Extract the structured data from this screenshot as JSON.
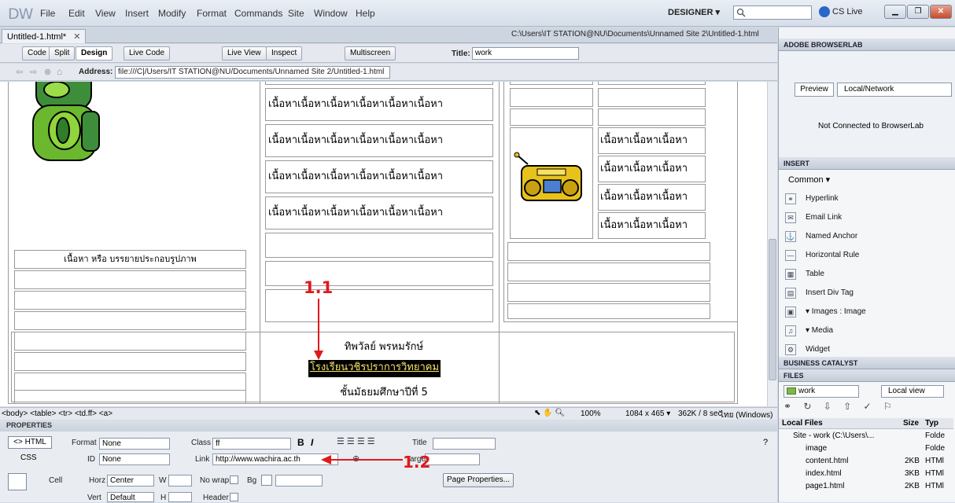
{
  "app": {
    "logo": "DW",
    "workspace": "DESIGNER ▾",
    "cslive": "CS Live"
  },
  "menu": [
    "File",
    "Edit",
    "View",
    "Insert",
    "Modify",
    "Format",
    "Commands",
    "Site",
    "Window",
    "Help"
  ],
  "doc": {
    "tab": "Untitled-1.html*",
    "path": "C:\\Users\\IT STATION@NU\\Documents\\Unnamed Site 2\\Untitled-1.html"
  },
  "toolbar": {
    "code": "Code",
    "split": "Split",
    "design": "Design",
    "live_code": "Live Code",
    "live_view": "Live View",
    "inspect": "Inspect",
    "multiscreen": "Multiscreen",
    "title_label": "Title:",
    "title_value": "work"
  },
  "address": {
    "label": "Address:",
    "value": "file:///C|/Users/IT STATION@NU/Documents/Unnamed Site 2/Untitled-1.html"
  },
  "design": {
    "caption": "เนื้อหา หรือ บรรยายประกอบรูปภาพ",
    "content_long": "เนื้อหาเนื้อหาเนื้อหาเนื้อหาเนื้อหาเนื้อหา",
    "content_short": "เนื้อหาเนื้อหาเนื้อหา",
    "footer_name": "ทิพวัลย์ พรหมรักษ์",
    "footer_link": "โรงเรียนวชิรปราการวิทยาคม",
    "footer_class": "ชั้นมัธยมศึกษาปีที่ 5"
  },
  "annotations": {
    "a1": "1.1",
    "a2": "1.2"
  },
  "tagbar": {
    "tags": "<body> <table> <tr> <td.ff> <a>",
    "zoom": "100%",
    "size": "1084 x 465 ▾",
    "stats": "362K / 8 sec",
    "encoding": "ไทย (Windows)"
  },
  "properties": {
    "heading": "PROPERTIES",
    "html_btn": "<> HTML",
    "css_btn": "CSS",
    "format_label": "Format",
    "format_value": "None",
    "id_label": "ID",
    "id_value": "None",
    "class_label": "Class",
    "class_value": "ff",
    "link_label": "Link",
    "link_value": "http://www.wachira.ac.th",
    "title_label": "Title",
    "target_label": "Target",
    "cell_label": "Cell",
    "horz_label": "Horz",
    "horz_value": "Center",
    "vert_label": "Vert",
    "vert_value": "Default",
    "w_label": "W",
    "h_label": "H",
    "nowrap_label": "No wrap",
    "header_label": "Header",
    "bg_label": "Bg",
    "page_props": "Page Properties..."
  },
  "browserlab": {
    "heading": "ADOBE BROWSERLAB",
    "preview": "Preview",
    "local": "Local/Network",
    "status": "Not Connected to BrowserLab"
  },
  "insert": {
    "heading": "INSERT",
    "category": "Common ▾",
    "items": [
      "Hyperlink",
      "Email Link",
      "Named Anchor",
      "Horizontal Rule",
      "Table",
      "Insert Div Tag",
      "▾ Images : Image",
      "▾ Media",
      "Widget"
    ]
  },
  "business": {
    "heading": "BUSINESS CATALYST"
  },
  "files": {
    "heading": "FILES",
    "site": "work",
    "view": "Local view",
    "col_local": "Local Files",
    "col_size": "Size",
    "col_type": "Typ",
    "rows": [
      {
        "name": "Site - work (C:\\Users\\...",
        "size": "",
        "type": "Folde"
      },
      {
        "name": "image",
        "size": "",
        "type": "Folde"
      },
      {
        "name": "content.html",
        "size": "2KB",
        "type": "HTMl"
      },
      {
        "name": "index.html",
        "size": "3KB",
        "type": "HTMl"
      },
      {
        "name": "page1.html",
        "size": "2KB",
        "type": "HTMl"
      }
    ]
  }
}
